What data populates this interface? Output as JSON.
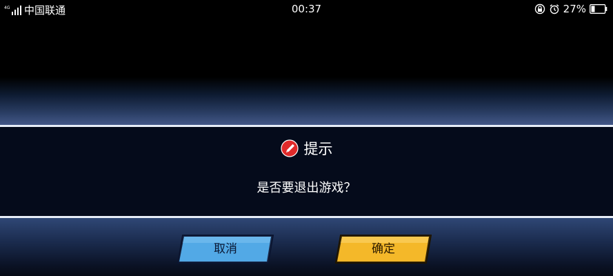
{
  "status_bar": {
    "carrier": "中国联通",
    "network_tag": "4G",
    "time": "00:37",
    "battery_percent": "27%",
    "battery_level": 0.27,
    "icons": [
      "signal-icon",
      "alarm-lock-icon",
      "alarm-clock-icon",
      "battery-icon"
    ]
  },
  "dialog": {
    "title": "提示",
    "message": "是否要退出游戏？",
    "icon": "alert-pencil-icon"
  },
  "buttons": {
    "cancel_label": "取消",
    "confirm_label": "确定"
  },
  "colors": {
    "cancel_button": "#52a9e6",
    "confirm_button": "#f4b829",
    "alert_icon": "#e02a2a",
    "panel": "#050b1b",
    "divider": "#e8eef8"
  }
}
